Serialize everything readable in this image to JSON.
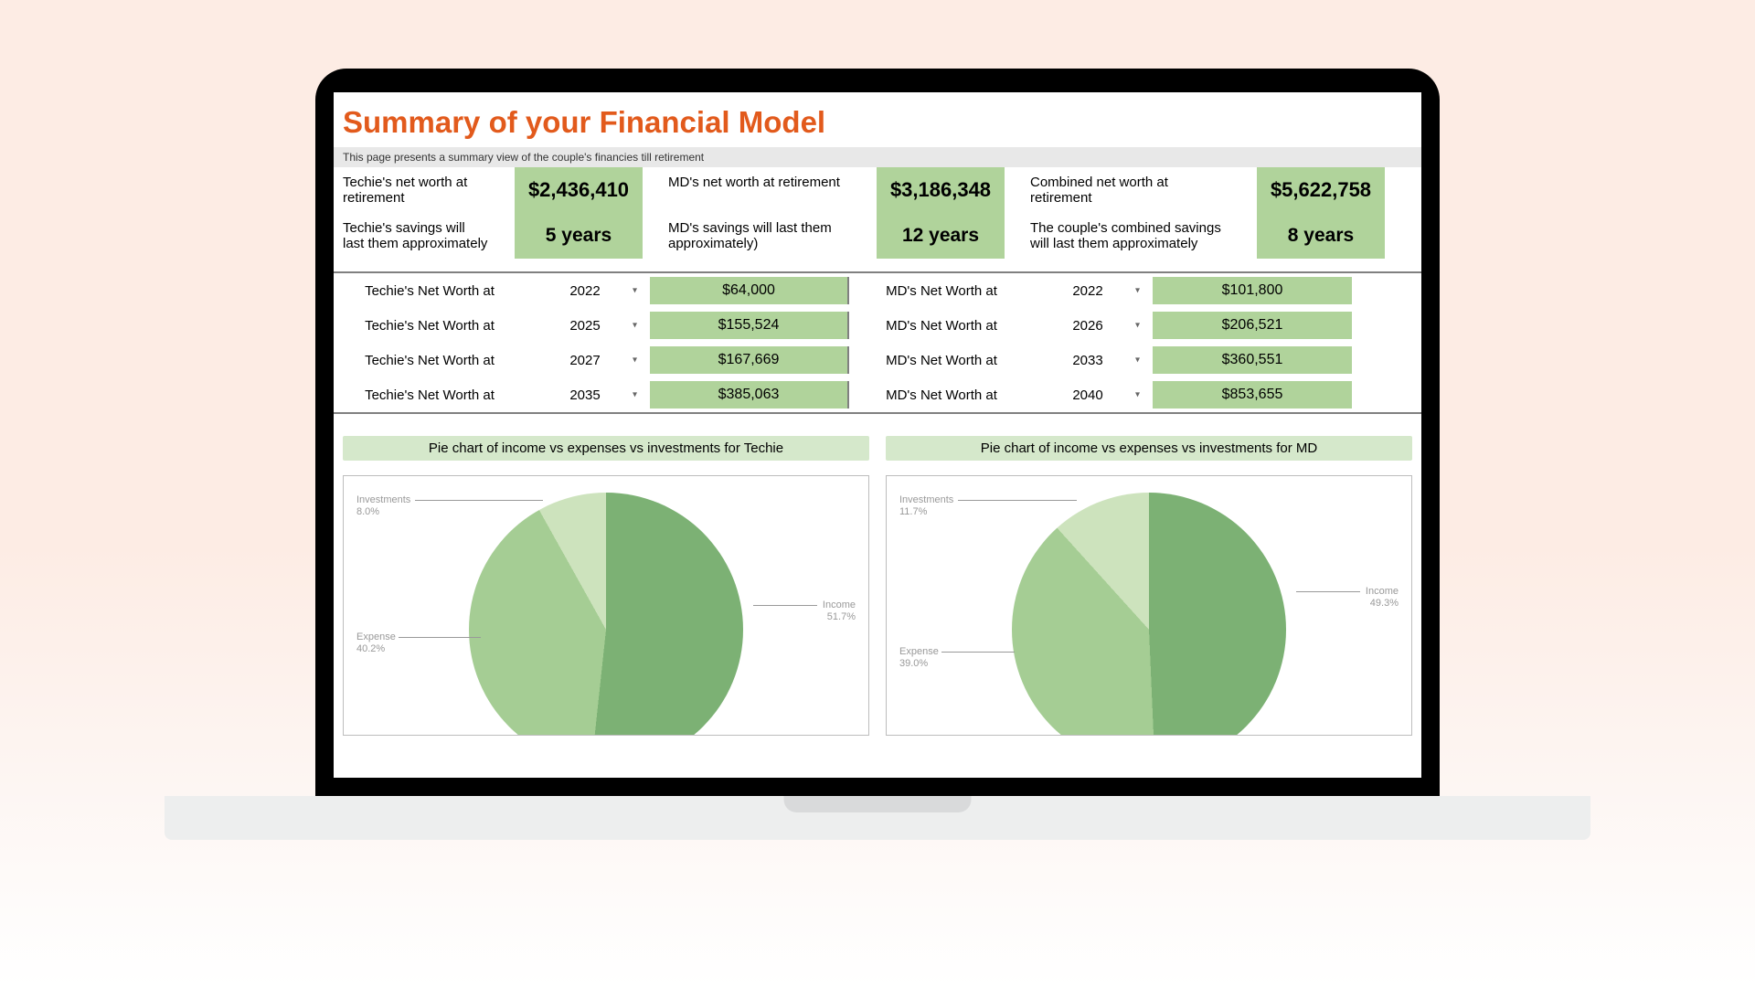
{
  "title": "Summary of your Financial Model",
  "subtitle": "This page presents a summary view of the couple's financies till retirement",
  "kpi": {
    "r1c1_label": "Techie's net worth at retirement",
    "r1c1_value": "$2,436,410",
    "r1c2_label": "MD's net worth at retirement",
    "r1c2_value": "$3,186,348",
    "r1c3_label": "Combined net worth at retirement",
    "r1c3_value": "$5,622,758",
    "r2c1_label": "Techie's savings will last them approximately",
    "r2c1_value": "5 years",
    "r2c2_label": "MD's savings will last them approximately)",
    "r2c2_value": "12 years",
    "r2c3_label": "The couple's combined savings will last them approximately",
    "r2c3_value": "8 years"
  },
  "rows": [
    {
      "l_label": "Techie's Net Worth at",
      "l_year": "2022",
      "l_amt": "$64,000",
      "r_label": "MD's Net Worth at",
      "r_year": "2022",
      "r_amt": "$101,800"
    },
    {
      "l_label": "Techie's Net Worth at",
      "l_year": "2025",
      "l_amt": "$155,524",
      "r_label": "MD's Net Worth at",
      "r_year": "2026",
      "r_amt": "$206,521"
    },
    {
      "l_label": "Techie's Net Worth at",
      "l_year": "2027",
      "l_amt": "$167,669",
      "r_label": "MD's Net Worth at",
      "r_year": "2033",
      "r_amt": "$360,551"
    },
    {
      "l_label": "Techie's Net Worth at",
      "l_year": "2035",
      "l_amt": "$385,063",
      "r_label": "MD's Net Worth at",
      "r_year": "2040",
      "r_amt": "$853,655"
    }
  ],
  "charts": {
    "left_title": "Pie chart of income vs expenses vs investments for Techie",
    "right_title": "Pie chart of income vs expenses vs investments for MD",
    "techie": {
      "investments_label": "Investments",
      "investments_pct": "8.0%",
      "expense_label": "Expense",
      "expense_pct": "40.2%",
      "income_label": "Income",
      "income_pct": "51.7%"
    },
    "md": {
      "investments_label": "Investments",
      "investments_pct": "11.7%",
      "expense_label": "Expense",
      "expense_pct": "39.0%",
      "income_label": "Income",
      "income_pct": "49.3%"
    }
  },
  "chart_data": [
    {
      "type": "pie",
      "title": "Pie chart of income vs expenses vs investments for Techie",
      "series": [
        {
          "name": "Income",
          "value": 51.7
        },
        {
          "name": "Expense",
          "value": 40.2
        },
        {
          "name": "Investments",
          "value": 8.0
        }
      ]
    },
    {
      "type": "pie",
      "title": "Pie chart of income vs expenses vs investments for MD",
      "series": [
        {
          "name": "Income",
          "value": 49.3
        },
        {
          "name": "Expense",
          "value": 39.0
        },
        {
          "name": "Investments",
          "value": 11.7
        }
      ]
    }
  ]
}
